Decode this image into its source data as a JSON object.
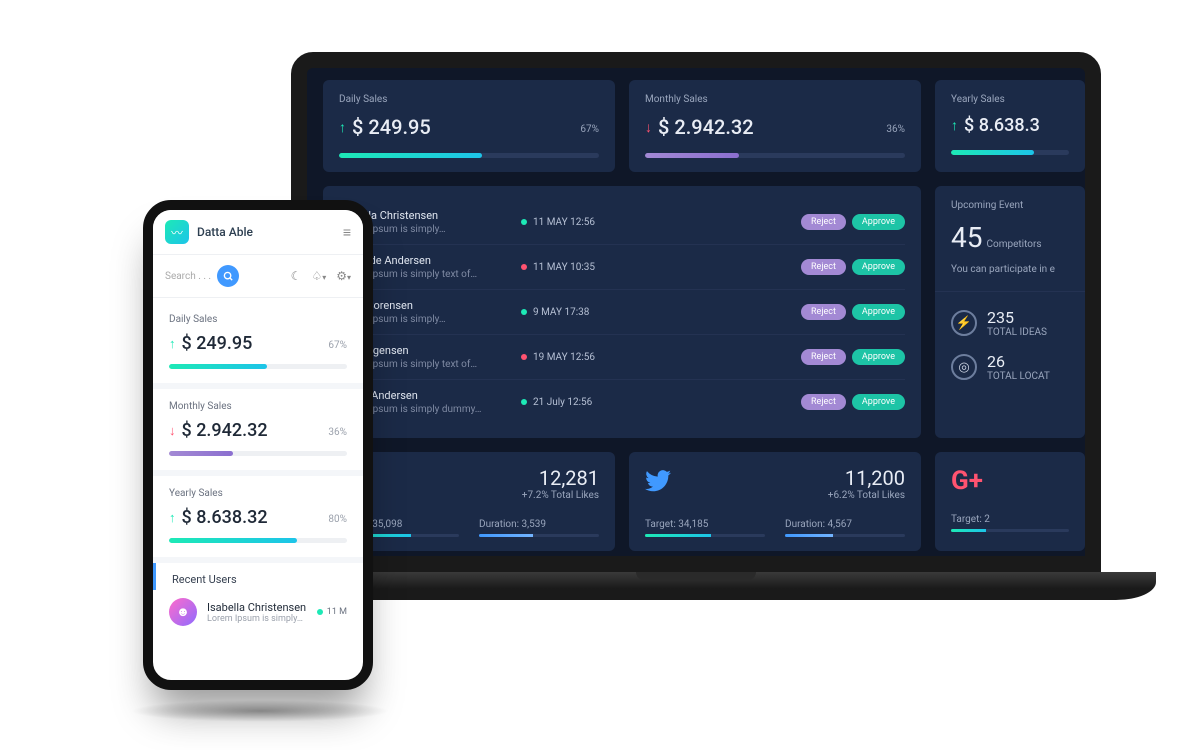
{
  "brand": "Datta Able",
  "search_placeholder": "Search . . .",
  "cards": {
    "daily": {
      "title": "Daily Sales",
      "value": "$ 249.95",
      "pct": "67%",
      "dir": "up"
    },
    "monthly": {
      "title": "Monthly Sales",
      "value": "$ 2.942.32",
      "pct": "36%",
      "dir": "down"
    },
    "yearly": {
      "title": "Yearly Sales",
      "value": "$ 8.638.32",
      "pct": "80%",
      "dir": "up"
    }
  },
  "desk_yearly_value": "$ 8.638.3",
  "users_header": "Recent Users",
  "users": [
    {
      "name": "Isabella Christensen",
      "sub": "Lorem Ipsum is simply…",
      "date": "11 MAY 12:56",
      "dot": "g"
    },
    {
      "name": "Mathilde Andersen",
      "sub": "Lorem Ipsum is simply text of…",
      "date": "11 MAY 10:35",
      "dot": "r"
    },
    {
      "name": "Karla Sorensen",
      "sub": "Lorem Ipsum is simply…",
      "date": "9 MAY 17:38",
      "dot": "g"
    },
    {
      "name": "Ida Jorgensen",
      "sub": "Lorem Ipsum is simply text of…",
      "date": "19 MAY 12:56",
      "dot": "r"
    },
    {
      "name": "Albert Andersen",
      "sub": "Lorem Ipsum is simply dummy…",
      "date": "21 July 12:56",
      "dot": "g"
    }
  ],
  "actions": {
    "reject": "Reject",
    "approve": "Approve"
  },
  "upcoming": {
    "title": "Upcoming Event",
    "count": "45",
    "count_label": "Competitors",
    "note": "You can participate in e"
  },
  "stats": {
    "ideas": {
      "value": "235",
      "label": "TOTAL IDEAS"
    },
    "locations": {
      "value": "26",
      "label": "TOTAL LOCAT"
    }
  },
  "social": {
    "fb": {
      "value": "12,281",
      "delta": "+7.2% Total Likes",
      "target_label": "Target:",
      "target": "35,098",
      "duration_label": "Duration:",
      "duration": "3,539"
    },
    "tw": {
      "value": "11,200",
      "delta": "+6.2% Total Likes",
      "target_label": "Target:",
      "target": "34,185",
      "duration_label": "Duration:",
      "duration": "4,567"
    },
    "gp": {
      "target_label": "Target:",
      "target": "2"
    }
  },
  "phone_user": {
    "name": "Isabella Christensen",
    "sub": "Lorem Ipsum is simply…",
    "date": "11 M"
  }
}
